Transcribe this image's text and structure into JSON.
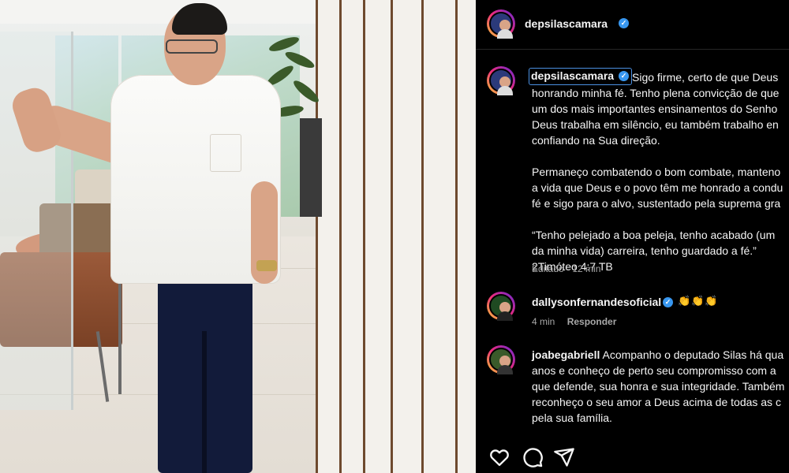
{
  "post": {
    "author": "depsilascamara",
    "caption_lines": [
      "Sigo firme, certo de que Deus",
      "honrando minha fé. Tenho plena convicção de que",
      "um dos mais importantes ensinamentos do Senho",
      "Deus trabalha em silêncio, eu também trabalho en",
      "confiando na Sua direção."
    ],
    "caption_para2": [
      "Permaneço combatendo o bom combate, manteno",
      "a vida que Deus e o povo têm me honrado a condu",
      "fé e sigo para o alvo, sustentado pela suprema gra"
    ],
    "caption_para3": [
      "“Tenho pelejado a boa peleja, tenho acabado (um",
      "da minha vida) carreira, tenho guardado a fé.”",
      "2Timóteo 4:7 TB"
    ],
    "edited_label": "Editado",
    "edited_time": "12 min"
  },
  "comments": [
    {
      "user": "dallysonfernandesoficial",
      "emoji": "👏👏👏",
      "time": "4 min",
      "reply_label": "Responder"
    },
    {
      "user": "joabegabriell",
      "lines": [
        "Acompanho o deputado Silas há qua",
        "anos e conheço de perto seu compromisso com a",
        "que defende, sua honra e sua integridade. Também",
        "reconheço o seu amor a Deus acima de todas as c",
        "pela sua família."
      ]
    }
  ],
  "icons": {
    "like": "heart-icon",
    "comment": "comment-icon",
    "share": "share-icon",
    "verified": "verified-badge-icon"
  },
  "colors": {
    "background": "#000000",
    "text": "#f5f5f5",
    "muted": "#a8a8a8",
    "verified": "#3897f0"
  }
}
